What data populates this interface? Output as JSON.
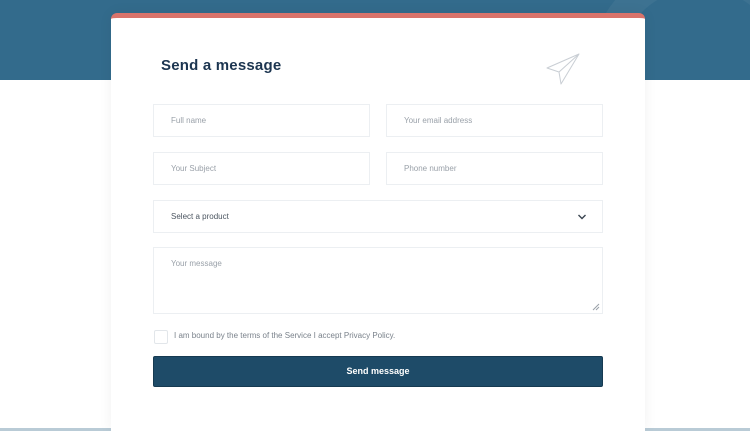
{
  "form": {
    "title": "Send a message",
    "fields": {
      "full_name_placeholder": "Full name",
      "email_placeholder": "Your email address",
      "subject_placeholder": "Your Subject",
      "phone_placeholder": "Phone number",
      "product_selected": "Select a product",
      "message_placeholder": "Your message"
    },
    "consent_text": "I am bound by the terms of the Service I accept Privacy Policy.",
    "submit_label": "Send message"
  },
  "icons": {
    "title": "paper-plane-icon",
    "select": "chevron-down-icon",
    "textarea": "resize-handle-icon"
  },
  "colors": {
    "header_band": "#336b8c",
    "card_accent": "#d9736b",
    "button": "#1e4b68",
    "title_text": "#1c3550"
  }
}
